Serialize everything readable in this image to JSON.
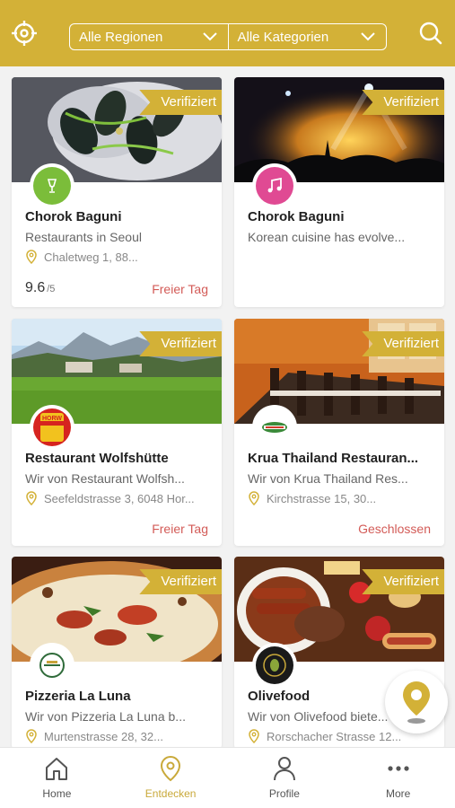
{
  "header": {
    "region_filter": "Alle Regionen",
    "category_filter": "Alle Kategorien",
    "icons": {
      "left": "crosshair-icon",
      "right": "search-icon"
    }
  },
  "colors": {
    "accent": "#d3b137",
    "status_red": "#d35b57",
    "nav_active": "#c9a93a"
  },
  "cards": [
    {
      "badge": "Verifiziert",
      "title": "Chorok Baguni",
      "subtitle": "Restaurants in Seoul",
      "address": "Chaletweg 1, 88...",
      "rating": "9.6",
      "rating_max": "/5",
      "status": "Freier Tag",
      "logo": "wine-glass-logo"
    },
    {
      "badge": "Verifiziert",
      "title": "Chorok Baguni",
      "subtitle": "Korean cuisine has evolve...",
      "address": "",
      "rating": "",
      "rating_max": "",
      "status": "",
      "logo": "music-note-logo"
    },
    {
      "badge": "Verifiziert",
      "title": "Restaurant Wolfshütte",
      "subtitle": "Wir von Restaurant Wolfsh...",
      "address": "Seefeldstrasse 3, 6048 Hor...",
      "rating": "",
      "rating_max": "",
      "status": "Freier Tag",
      "logo": "HORW"
    },
    {
      "badge": "Verifiziert",
      "title": "Krua Thailand Restauran...",
      "subtitle": "Wir von Krua Thailand Res...",
      "address": "Kirchstrasse 15, 30...",
      "rating": "",
      "rating_max": "",
      "status": "Geschlossen",
      "logo": "krua-thailand-logo"
    },
    {
      "badge": "Verifiziert",
      "title": "Pizzeria La Luna",
      "subtitle": "Wir von Pizzeria La Luna b...",
      "address": "Murtenstrasse 28, 32...",
      "rating": "",
      "rating_max": "",
      "status": "",
      "logo": "pizzeria-logo"
    },
    {
      "badge": "Verifiziert",
      "title": "Olivefood",
      "subtitle": "Wir von Olivefood biete...",
      "address": "Rorschacher Strasse 12...",
      "rating": "",
      "rating_max": "",
      "status": "",
      "logo": "olivefood-logo"
    }
  ],
  "nav": [
    {
      "label": "Home",
      "icon": "home-icon"
    },
    {
      "label": "Entdecken",
      "icon": "location-pin-icon",
      "active": true
    },
    {
      "label": "Profile",
      "icon": "user-icon"
    },
    {
      "label": "More",
      "icon": "more-dots-icon"
    }
  ],
  "fab": {
    "icon": "map-pin-icon"
  }
}
